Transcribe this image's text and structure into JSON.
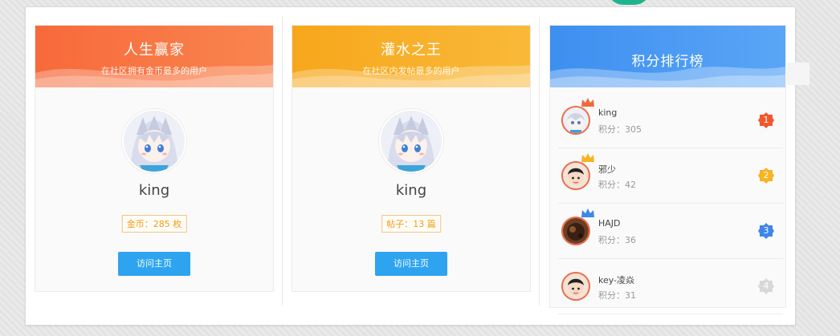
{
  "cards": [
    {
      "title": "人生赢家",
      "subtitle": "在社区拥有金币最多的用户",
      "gradient_from": "#f76a3a",
      "gradient_to": "#f9854f",
      "user": "king",
      "stat": "金币：285 枚",
      "button": "访问主页"
    },
    {
      "title": "灌水之王",
      "subtitle": "在社区内发帖最多的用户",
      "gradient_from": "#f7a71b",
      "gradient_to": "#f9b939",
      "user": "king",
      "stat": "帖子：13 篇",
      "button": "访问主页"
    }
  ],
  "ranking": {
    "title": "积分排行榜",
    "gradient_from": "#3d8ff0",
    "gradient_to": "#5aa5f6",
    "rows": [
      {
        "name": "king",
        "score": "积分：305",
        "rank": "1",
        "badge_color": "#f1582c",
        "crown_color": "#ef6a3b",
        "avatar": "anime"
      },
      {
        "name": "邪少",
        "score": "积分：42",
        "rank": "2",
        "badge_color": "#f7b322",
        "crown_color": "#f7b322",
        "avatar": "boy"
      },
      {
        "name": "HAJD",
        "score": "积分：36",
        "rank": "3",
        "badge_color": "#3f86ea",
        "crown_color": "#3f86ea",
        "avatar": "dark"
      },
      {
        "name": "key-凌焱",
        "score": "积分：31",
        "rank": "4",
        "badge_color": "#d8d8d8",
        "crown_color": "",
        "avatar": "boy"
      }
    ]
  }
}
